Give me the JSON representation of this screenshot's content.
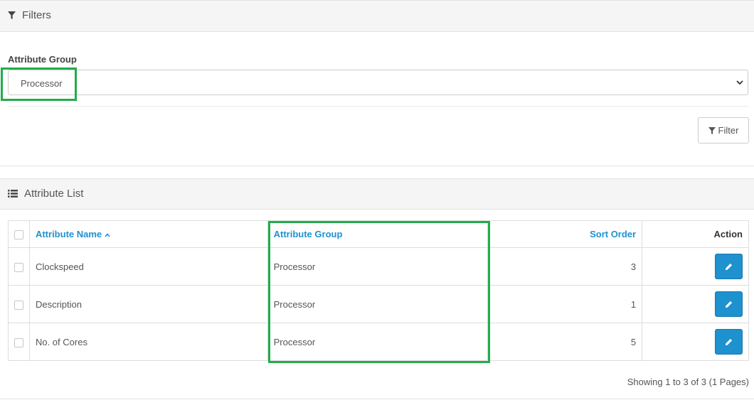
{
  "filters": {
    "heading": "Filters",
    "group_label": "Attribute Group",
    "selected_group": "Processor",
    "filter_button": "Filter"
  },
  "list": {
    "heading": "Attribute List",
    "columns": {
      "name": "Attribute Name",
      "group": "Attribute Group",
      "sort": "Sort Order",
      "action": "Action"
    },
    "rows": [
      {
        "name": "Clockspeed",
        "group": "Processor",
        "sort": "3"
      },
      {
        "name": "Description",
        "group": "Processor",
        "sort": "1"
      },
      {
        "name": "No. of Cores",
        "group": "Processor",
        "sort": "5"
      }
    ],
    "pagination": "Showing 1 to 3 of 3 (1 Pages)"
  },
  "colors": {
    "accent": "#1e91cf",
    "highlight": "#22ac4c"
  },
  "icons": [
    "filter-icon",
    "list-icon",
    "chevron-down-icon",
    "sort-asc-icon",
    "pencil-icon"
  ]
}
